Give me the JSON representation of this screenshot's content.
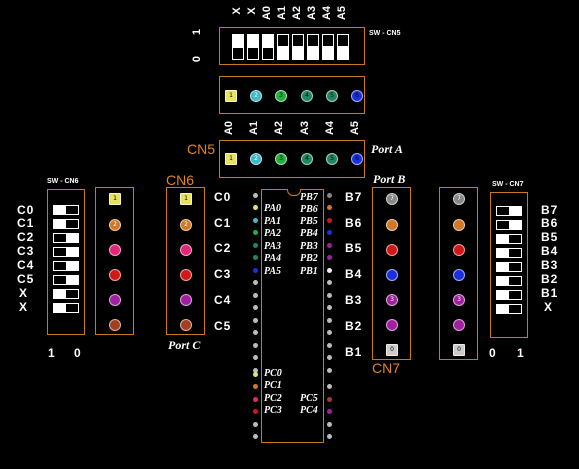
{
  "top_switch": {
    "switch_labels": [
      "X",
      "X",
      "A0",
      "A1",
      "A2",
      "A3",
      "A4",
      "A5"
    ],
    "title": "SW - CN5",
    "value_1": "1",
    "value_0": "0"
  },
  "port_a": {
    "labels": [
      "A0",
      "A1",
      "A2",
      "A3",
      "A4",
      "A5"
    ],
    "connector": "CN5",
    "name": "Port A"
  },
  "port_b": {
    "name": "Port B",
    "connector": "CN7",
    "labels": [
      "B7",
      "B6",
      "B5",
      "B4",
      "B3",
      "B2",
      "B1"
    ]
  },
  "port_c": {
    "name": "Port C",
    "connector": "CN6",
    "labels": [
      "C0",
      "C1",
      "C2",
      "C3",
      "C4",
      "C5"
    ]
  },
  "left_switch": {
    "title": "SW - CN6",
    "labels": [
      "C0",
      "C1",
      "C2",
      "C3",
      "C4",
      "C5",
      "X",
      "X"
    ],
    "value_1": "1",
    "value_0": "0"
  },
  "right_switch": {
    "title": "SW - CN7",
    "labels": [
      "B7",
      "B6",
      "B5",
      "B4",
      "B3",
      "B2",
      "B1",
      "X"
    ],
    "value_0": "0",
    "value_1": "1"
  },
  "chip": {
    "left_pins": [
      "PA0",
      "PA1",
      "PA2",
      "PA3",
      "PA4",
      "PA5"
    ],
    "right_pins": [
      "PB7",
      "PB6",
      "PB5",
      "PB4",
      "PB3",
      "PB2",
      "PB1"
    ],
    "left_pc_pins": [
      "PC0",
      "PC1",
      "PC2",
      "PC3"
    ],
    "right_pc_pins": [
      "PC5",
      "PC4"
    ]
  },
  "led_badges": {
    "square": "1",
    "n2": "2",
    "n3": "3",
    "n4": "4",
    "n5": "5",
    "n6": "6",
    "n7": "7",
    "n0": "0"
  },
  "colors": {
    "border": "#c8781e",
    "orange_text": "#e0842a",
    "led_yellow": "#e8e060",
    "led_cyan": "#40b8c8",
    "led_green": "#20b040",
    "led_teal": "#208860",
    "led_blue": "#1830e0",
    "led_orange": "#d07828",
    "led_pink": "#e02878",
    "led_red": "#d01818",
    "led_purple": "#a020a0",
    "led_brown": "#a04020",
    "led_grey": "#888888"
  }
}
